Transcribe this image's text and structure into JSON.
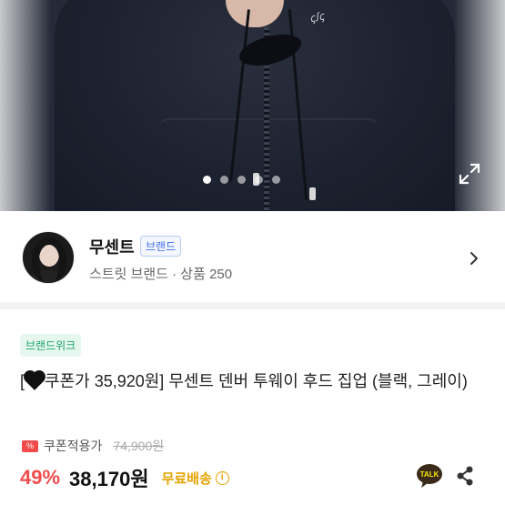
{
  "gallery": {
    "dots": [
      true,
      false,
      false,
      false,
      false
    ],
    "expand_icon": "expand-icon",
    "logo_text": "ꞔꭍꞔ"
  },
  "seller": {
    "name": "무센트",
    "badge": "브랜드",
    "subtitle": "스트릿 브랜드 · 상품 250",
    "chevron_icon": "chevron-right-icon"
  },
  "product": {
    "tag": "브랜드위크",
    "title_prefix": "[",
    "title_coupon": "쿠폰가 35,920원] 무센트 덴버 투웨이 후드 집업 (블랙, 그레이)",
    "coupon_label": "쿠폰적용가",
    "original_price": "74,900원",
    "discount": "49%",
    "price": "38,170원",
    "shipping": "무료배송",
    "talk_label": "TALK"
  },
  "colors": {
    "discount": "#f04c4c",
    "shipping": "#e4a400",
    "tag": "#1aa36b",
    "badge": "#3d6fe8"
  }
}
